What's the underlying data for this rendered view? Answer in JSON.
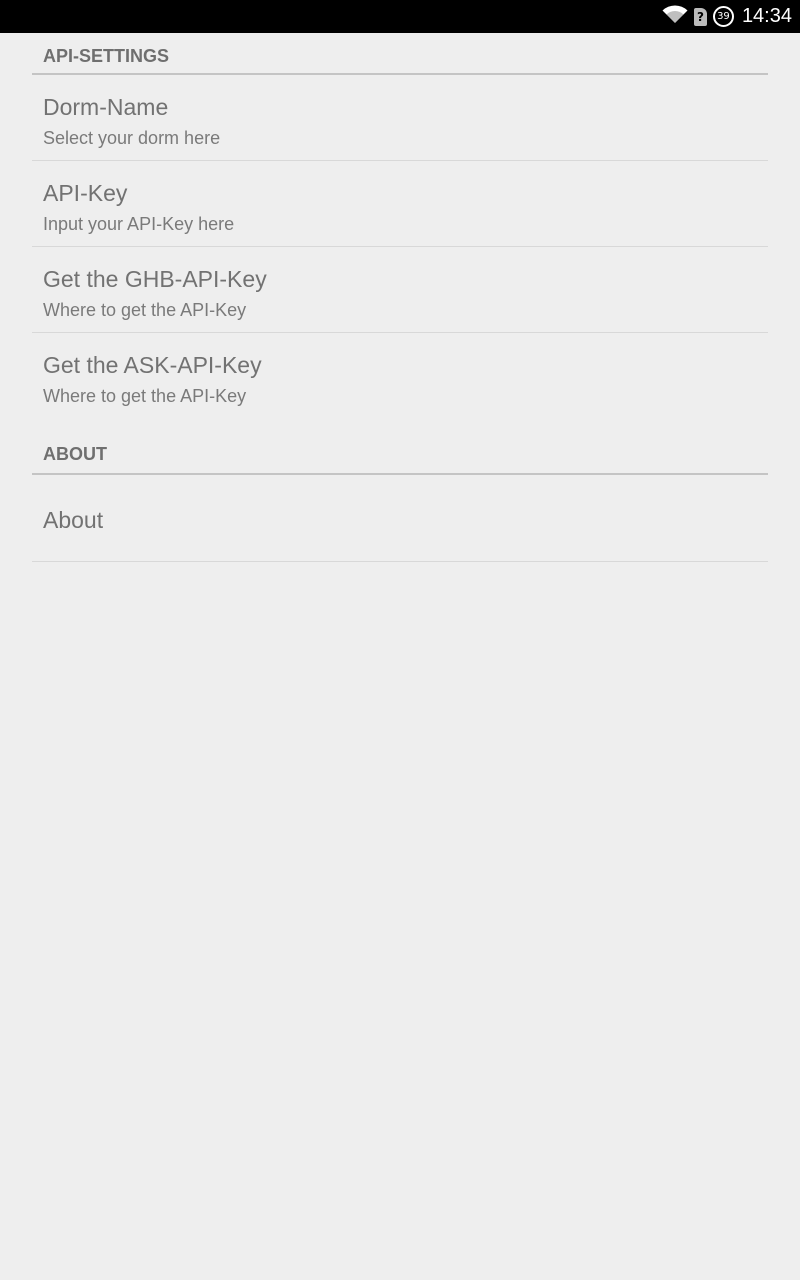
{
  "status_bar": {
    "time": "14:34",
    "battery_level": "39",
    "icons": [
      "wifi-icon",
      "sim-unknown-icon",
      "battery-icon"
    ]
  },
  "preferences": {
    "api_settings": {
      "header": "API-SETTINGS",
      "items": [
        {
          "title": "Dorm-Name",
          "summary": "Select your dorm here"
        },
        {
          "title": "API-Key",
          "summary": "Input your API-Key here"
        },
        {
          "title": "Get the GHB-API-Key",
          "summary": "Where to get the API-Key"
        },
        {
          "title": "Get the ASK-API-Key",
          "summary": "Where to get the API-Key"
        }
      ]
    },
    "about": {
      "header": "ABOUT",
      "items": [
        {
          "title": "About"
        }
      ]
    }
  },
  "colors": {
    "background": "#eeeeee",
    "status_bar": "#000000",
    "category_text": "#6f6f6f",
    "title_text": "#727272",
    "divider": "#c4c4c4"
  }
}
